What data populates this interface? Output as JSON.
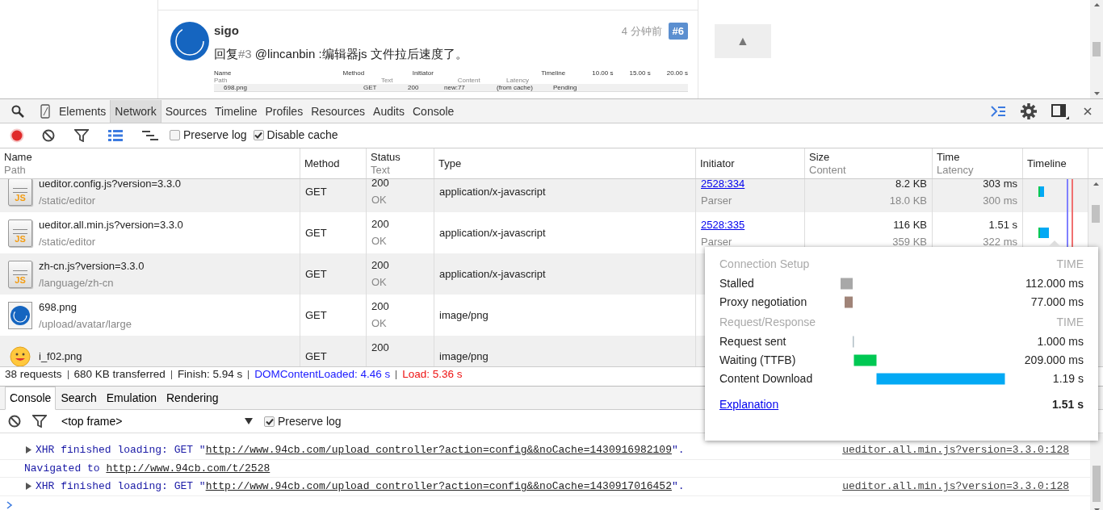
{
  "page": {
    "post": {
      "author": "sigo",
      "time": "4 分钟前",
      "floor": "#6",
      "reply_prefix": "回复",
      "reply_ref": "#3",
      "reply_text": " @lincanbin :编辑器js 文件拉后速度了。"
    },
    "embedded_screenshot": {
      "headers": [
        {
          "title": "Name",
          "subtitle": "Path"
        },
        {
          "title": "Method"
        },
        {
          "subtitle": "Text"
        },
        {
          "title": "Initiator"
        },
        {
          "subtitle": "Content"
        },
        {
          "subtitle": "Latency"
        },
        {
          "title": "Timeline"
        }
      ],
      "ticks": [
        "10.00 s",
        "15.00 s",
        "20.00 s"
      ],
      "row": {
        "name": "698.png",
        "method": "GET",
        "status": "200",
        "initiator": "new:77",
        "size": "(from cache)",
        "time": "Pending"
      }
    },
    "scroll_top_button": "▲"
  },
  "devtools": {
    "tabs": [
      {
        "label": "Elements",
        "selected": false
      },
      {
        "label": "Network",
        "selected": true
      },
      {
        "label": "Sources",
        "selected": false
      },
      {
        "label": "Timeline",
        "selected": false
      },
      {
        "label": "Profiles",
        "selected": false
      },
      {
        "label": "Resources",
        "selected": false
      },
      {
        "label": "Audits",
        "selected": false
      },
      {
        "label": "Console",
        "selected": false
      }
    ],
    "toolbar": {
      "recording": true,
      "large_rows": true,
      "preserve_log": {
        "label": "Preserve log",
        "checked": false
      },
      "disable_cache": {
        "label": "Disable cache",
        "checked": true
      }
    },
    "columns": [
      {
        "title": "Name",
        "subtitle": "Path"
      },
      {
        "title": "Method"
      },
      {
        "title": "Status",
        "subtitle": "Text"
      },
      {
        "title": "Type"
      },
      {
        "title": "Initiator"
      },
      {
        "title": "Size",
        "subtitle": "Content"
      },
      {
        "title": "Time",
        "subtitle": "Latency"
      },
      {
        "title": "Timeline"
      }
    ],
    "requests": [
      {
        "kind": "script",
        "icon_label": "JS",
        "name": "ueditor.config.js?version=3.3.0",
        "path": "/static/editor",
        "method": "GET",
        "status": "200",
        "status_text": "OK",
        "type": "application/x-javascript",
        "initiator": "2528:334",
        "initiator_sub": "Parser",
        "size": "8.2 KB",
        "content": "18.0 KB",
        "time": "303 ms",
        "latency": "300 ms",
        "timeline": {
          "kind": "short"
        }
      },
      {
        "kind": "script",
        "icon_label": "JS",
        "name": "ueditor.all.min.js?version=3.3.0",
        "path": "/static/editor",
        "method": "GET",
        "status": "200",
        "status_text": "OK",
        "type": "application/x-javascript",
        "initiator": "2528:335",
        "initiator_sub": "Parser",
        "size": "116 KB",
        "content": "359 KB",
        "time": "1.51 s",
        "latency": "322 ms",
        "timeline": {
          "kind": "long"
        }
      },
      {
        "kind": "script",
        "icon_label": "JS",
        "name": "zh-cn.js?version=3.3.0",
        "path": "/language/zh-cn",
        "method": "GET",
        "status": "200",
        "status_text": "OK",
        "type": "application/x-javascript"
      },
      {
        "kind": "image",
        "name": "698.png",
        "path": "/upload/avatar/large",
        "method": "GET",
        "status": "200",
        "status_text": "OK",
        "type": "image/png"
      },
      {
        "kind": "emoticon",
        "name": "i_f02.png",
        "method": "GET",
        "status": "200",
        "type": "image/png"
      }
    ],
    "summary": [
      {
        "kind": "plain",
        "text": "38 requests"
      },
      {
        "kind": "plain",
        "text": "680 KB transferred"
      },
      {
        "kind": "plain",
        "text": "Finish: 5.94 s"
      },
      {
        "kind": "dom",
        "text": "DOMContentLoaded: 4.46 s"
      },
      {
        "kind": "load",
        "text": "Load: 5.36 s"
      }
    ],
    "timing_popup": {
      "sections": [
        {
          "heading": "Connection Setup",
          "time_heading": "TIME",
          "rows": [
            {
              "label": "Stalled",
              "value": "112.000 ms",
              "color": "#a8a8a8"
            },
            {
              "label": "Proxy negotiation",
              "value": "77.000 ms",
              "color": "#a08478"
            }
          ]
        },
        {
          "heading": "Request/Response",
          "time_heading": "TIME",
          "rows": [
            {
              "label": "Request sent",
              "value": "1.000 ms",
              "color": "#b0bec5"
            },
            {
              "label": "Waiting (TTFB)",
              "value": "209.000 ms",
              "color": "#00c853"
            },
            {
              "label": "Content Download",
              "value": "1.19 s",
              "color": "#03a9f4"
            }
          ]
        }
      ],
      "link": "Explanation",
      "total": "1.51 s"
    },
    "drawer_tabs": [
      {
        "label": "Console",
        "selected": true
      },
      {
        "label": "Search",
        "selected": false
      },
      {
        "label": "Emulation",
        "selected": false
      },
      {
        "label": "Rendering",
        "selected": false
      }
    ],
    "console_toolbar": {
      "context": "<top frame>",
      "preserve_log": {
        "label": "Preserve log",
        "checked": true
      }
    },
    "messages": [
      {
        "kind": "xhr",
        "before": "XHR finished loading: GET \"",
        "link": "http://www.94cb.com/upload_controller?action=config&&noCache=1430916982109",
        "after": "\".",
        "source": "ueditor.all.min.js?version=3.3.0:128"
      },
      {
        "kind": "navigated",
        "before": "Navigated to ",
        "link": "http://www.94cb.com/t/2528"
      },
      {
        "kind": "xhr",
        "before": "XHR finished loading: GET \"",
        "link": "http://www.94cb.com/upload_controller?action=config&&noCache=1430917016452",
        "after": "\".",
        "source": "ueditor.all.min.js?version=3.3.0:128"
      }
    ]
  }
}
